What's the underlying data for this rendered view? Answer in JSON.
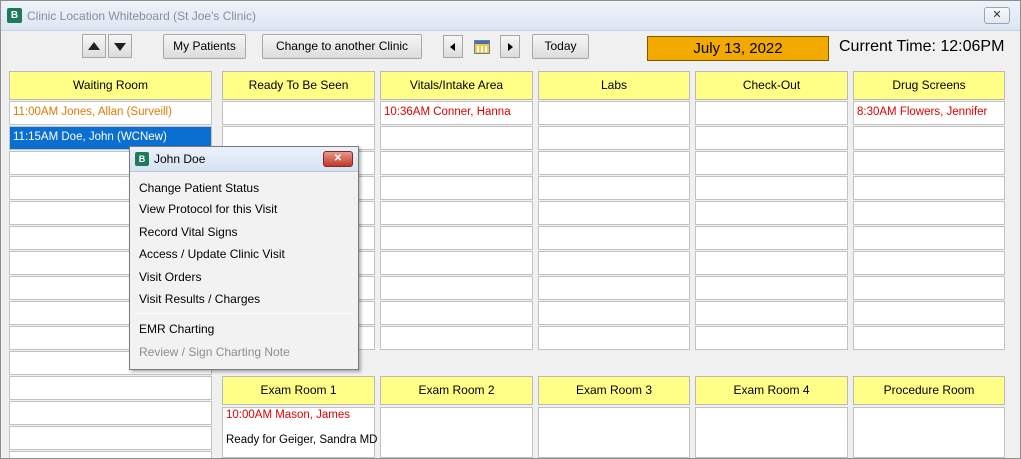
{
  "window": {
    "title": "Clinic Location Whiteboard (St Joe's Clinic)",
    "close_label": "✕"
  },
  "toolbar": {
    "my_patients_label": "My Patients",
    "change_clinic_label": "Change to another Clinic",
    "today_label": "Today",
    "date": "July 13, 2022",
    "current_time": "Current Time: 12:06PM"
  },
  "columns": [
    {
      "title": "Waiting Room",
      "entries": [
        "11:00AM Jones, Allan (Surveill)",
        "11:15AM Doe, John (WCNew)"
      ]
    },
    {
      "title": "Ready To Be Seen",
      "entries": []
    },
    {
      "title": "Vitals/Intake Area",
      "entries": [
        "10:36AM Conner, Hanna"
      ]
    },
    {
      "title": "Labs",
      "entries": []
    },
    {
      "title": "Check-Out",
      "entries": []
    },
    {
      "title": "Drug Screens",
      "entries": [
        "8:30AM Flowers, Jennifer"
      ]
    }
  ],
  "exam_rooms": [
    {
      "title": "Exam Room 1",
      "lines": [
        "10:00AM Mason, James",
        "Ready for Geiger, Sandra  MD"
      ]
    },
    {
      "title": "Exam Room 2",
      "lines": []
    },
    {
      "title": "Exam Room 3",
      "lines": []
    },
    {
      "title": "Exam Room 4",
      "lines": []
    },
    {
      "title": "Procedure Room",
      "lines": []
    }
  ],
  "popup": {
    "title": "John Doe",
    "close_label": "✕",
    "items": [
      "Change Patient Status",
      "View Protocol for this Visit",
      "Record Vital Signs",
      "Access / Update Clinic Visit",
      "Visit Orders",
      "Visit Results / Charges",
      "EMR Charting",
      "Review / Sign Charting Note"
    ]
  },
  "colors": {
    "header_yellow": "#ffff88",
    "date_orange": "#f2a900",
    "selected_blue": "#0a6fd0",
    "entry_orange": "#e07b00",
    "entry_red": "#e00000"
  }
}
